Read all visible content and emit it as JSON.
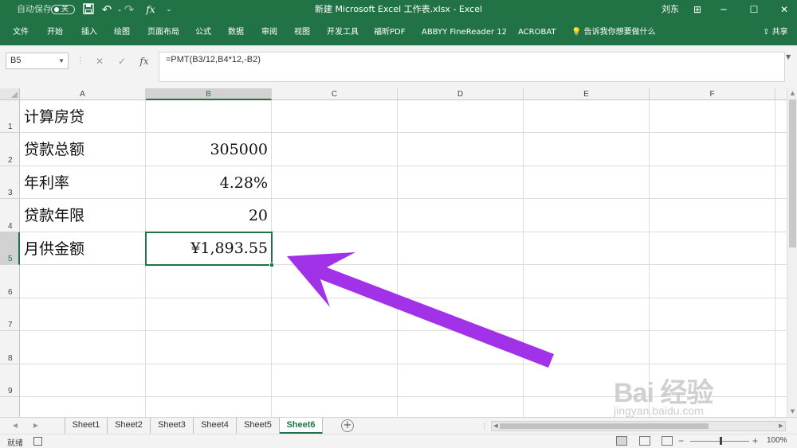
{
  "titlebar": {
    "autosave_label": "自动保存",
    "autosave_state": "关",
    "doc_title": "新建 Microsoft Excel 工作表.xlsx  -  Excel",
    "user": "刘东",
    "icons": [
      "save-icon",
      "undo-icon",
      "redo-icon",
      "fx-icon",
      "customize-qat-icon",
      "ribbon-display-icon",
      "minimize-icon",
      "maximize-icon",
      "close-icon"
    ],
    "undo_glyph": "↶",
    "redo_glyph": "↷",
    "fx_glyph": "fx",
    "qat_more": "⌄",
    "min_glyph": "─",
    "max_glyph": "☐",
    "close_glyph": "✕",
    "ribbon_opts_glyph": "⊞",
    "save_glyph": "🖫"
  },
  "ribbon": {
    "tabs": [
      "文件",
      "开始",
      "插入",
      "绘图",
      "页面布局",
      "公式",
      "数据",
      "审阅",
      "视图",
      "开发工具",
      "福昕PDF",
      "ABBYY FineReader 12",
      "ACROBAT"
    ],
    "tell_me": "告诉我你想要做什么",
    "share": "共享"
  },
  "formula_bar": {
    "name_box": "B5",
    "formula": "=PMT(B3/12,B4*12,-B2)",
    "cancel_glyph": "✕",
    "enter_glyph": "✓",
    "fx_glyph": "fx"
  },
  "grid": {
    "columns": [
      "A",
      "B",
      "C",
      "D",
      "E",
      "F"
    ],
    "selected_column": "B",
    "rows": [
      "1",
      "2",
      "3",
      "4",
      "5",
      "6",
      "7",
      "8",
      "9"
    ],
    "selected_row": "5",
    "cells": {
      "A1": "计算房贷",
      "A2": "贷款总额",
      "A3": "年利率",
      "A4": "贷款年限",
      "A5": "月供金额",
      "B2": "305000",
      "B3": "4.28%",
      "B4": "20",
      "B5": "¥1,893.55"
    },
    "active_cell": "B5"
  },
  "sheet_tabs": {
    "tabs": [
      "Sheet1",
      "Sheet2",
      "Sheet3",
      "Sheet4",
      "Sheet5",
      "Sheet6"
    ],
    "active": "Sheet6",
    "add_glyph": "+"
  },
  "status": {
    "ready": "就绪",
    "zoom": "100%"
  },
  "annotation": {
    "arrow_color": "#a232e8"
  },
  "watermark": {
    "main": "Bai 经验",
    "sub": "jingyan.baidu.com"
  },
  "colors": {
    "excel_green": "#217346",
    "selection_header": "#d2d2d2"
  }
}
